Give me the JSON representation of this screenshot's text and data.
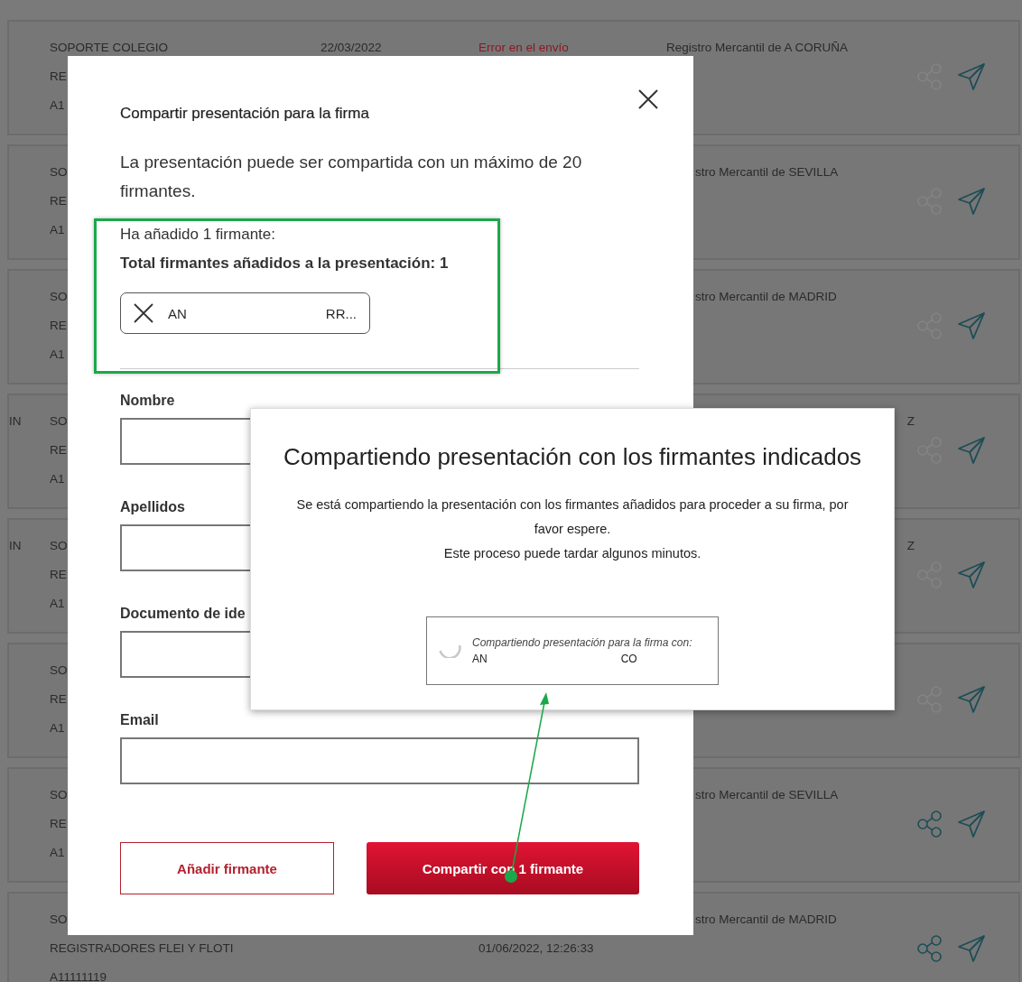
{
  "rows": [
    {
      "lines": [
        "SOPORTE COLEGIO",
        "RE",
        "A1"
      ],
      "date": "22/03/2022",
      "status": "Error en el envío",
      "registry": "Registro Mercantil de A CORUÑA",
      "share_enabled": false
    },
    {
      "lines": [
        "SO",
        "RE",
        "A1"
      ],
      "registry": "stro Mercantil de SEVILLA",
      "share_enabled": false
    },
    {
      "lines": [
        "SO",
        "RE",
        "A1"
      ],
      "registry": "stro Mercantil de MADRID",
      "share_enabled": false
    },
    {
      "prefix": "IN",
      "lines": [
        "SO",
        "RE",
        "A1"
      ],
      "registry_end": "Z",
      "share_enabled": false
    },
    {
      "prefix": "IN",
      "lines": [
        "SO",
        "RE",
        "A1"
      ],
      "registry_end": "Z",
      "share_enabled": false
    },
    {
      "lines": [
        "SO",
        "RE",
        "A1"
      ],
      "share_enabled": false
    },
    {
      "lines": [
        "SO",
        "RE",
        "A1"
      ],
      "registry": "stro Mercantil de SEVILLA",
      "share_enabled": true
    },
    {
      "lines": [
        "SO",
        "REGISTRADORES FLEI Y FLOTI",
        "A11111119"
      ],
      "date_line2": "01/06/2022, 12:26:33",
      "registry": "stro Mercantil de MADRID",
      "share_enabled": true
    }
  ],
  "share_dialog": {
    "title": "Compartir presentación para la firma",
    "intro": "La presentación puede ser compartida con un máximo de 20 firmantes.",
    "added": "Ha añadido 1 firmante:",
    "total": "Total firmantes añadidos a la presentación: 1",
    "signers": [
      {
        "first": "AN",
        "last": "RR..."
      }
    ],
    "fields": [
      {
        "label": "Nombre"
      },
      {
        "label": "Apellidos"
      },
      {
        "label": "Documento de ide"
      },
      {
        "label": "Email"
      }
    ],
    "buttons": [
      {
        "label": "Añadir firmante",
        "kind": "secondary"
      },
      {
        "label": "Compartir con 1 firmante",
        "kind": "primary"
      }
    ]
  },
  "progress_dialog": {
    "title": "Compartiendo presentación con los firmantes indicados",
    "message": "Se está compartiendo la presentación con los firmantes añadidos para proceder a su firma, por favor espere.",
    "note": "Este proceso puede tardar algunos minutos.",
    "status": "Compartiendo presentación para la firma con:",
    "signer_first": "AN",
    "signer_last": "CO"
  }
}
